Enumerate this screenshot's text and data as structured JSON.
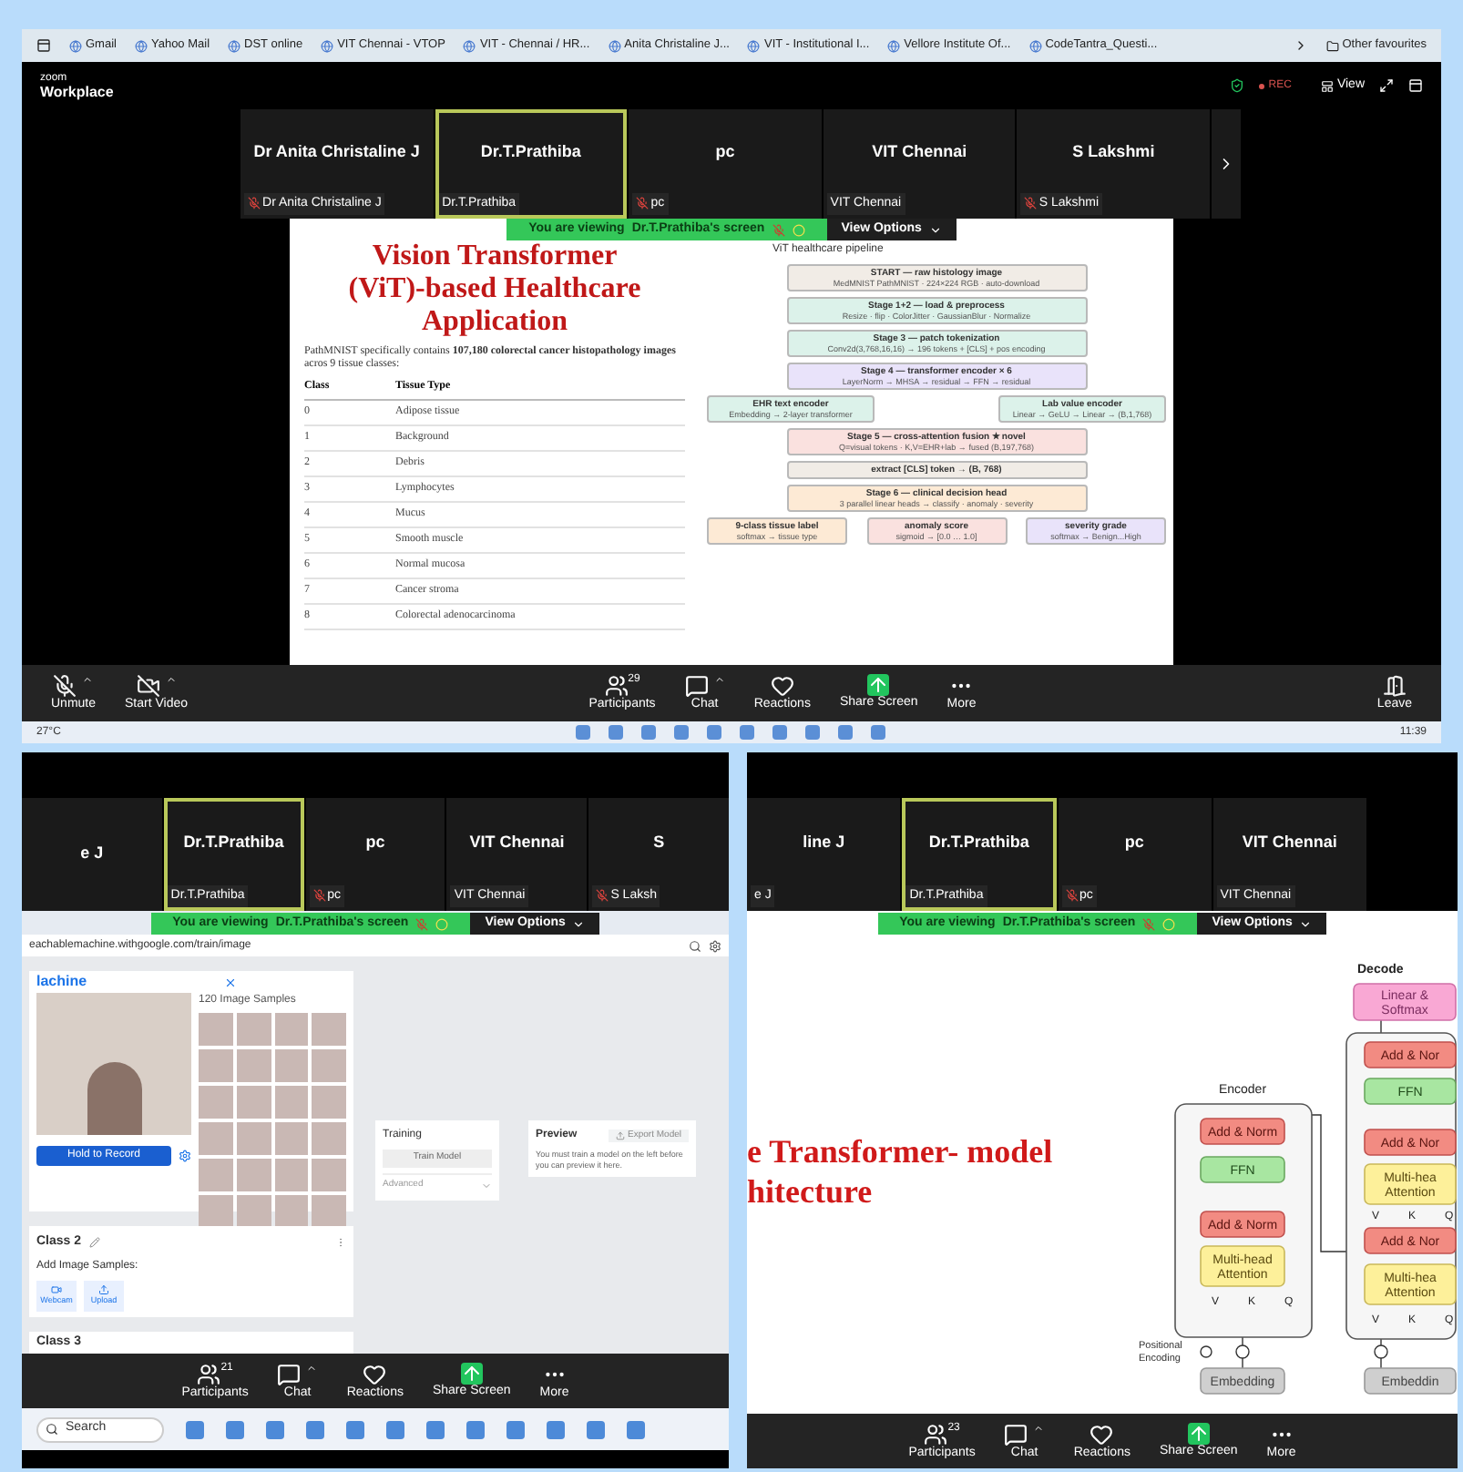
{
  "bookmarks": {
    "items": [
      "Gmail",
      "Yahoo Mail",
      "DST online",
      "VIT Chennai - VTOP",
      "VIT - Chennai / HR...",
      "Anita Christaline J...",
      "VIT - Institutional I...",
      "Vellore Institute Of...",
      "CodeTantra_Questi..."
    ],
    "other": "Other favourites"
  },
  "top_meeting": {
    "app_small": "zoom",
    "app_name": "Workplace",
    "rec": "REC",
    "view": "View",
    "participants": [
      {
        "title": "Dr Anita Christaline J",
        "label": "Dr Anita Christaline J",
        "muted": true,
        "selected": false
      },
      {
        "title": "Dr.T.Prathiba",
        "label": "Dr.T.Prathiba",
        "muted": false,
        "selected": true
      },
      {
        "title": "pc",
        "label": "pc",
        "muted": true,
        "selected": false
      },
      {
        "title": "VIT Chennai",
        "label": "VIT Chennai",
        "muted": false,
        "selected": false
      },
      {
        "title": "S Lakshmi",
        "label": "S Lakshmi",
        "muted": true,
        "selected": false
      }
    ],
    "banner": {
      "text": "You are viewing",
      "name": "Dr.T.Prathiba's screen",
      "view_options": "View Options"
    },
    "slide": {
      "title": "Vision Transformer (ViT)-based Healthcare Application",
      "paragraph": "PathMNIST specifically contains **107,180 colorectal cancer histopathology images** acros 9 tissue classes:",
      "columns": [
        "Class",
        "Tissue Type"
      ],
      "rows": [
        [
          "0",
          "Adipose tissue"
        ],
        [
          "1",
          "Background"
        ],
        [
          "2",
          "Debris"
        ],
        [
          "3",
          "Lymphocytes"
        ],
        [
          "4",
          "Mucus"
        ],
        [
          "5",
          "Smooth muscle"
        ],
        [
          "6",
          "Normal mucosa"
        ],
        [
          "7",
          "Cancer stroma"
        ],
        [
          "8",
          "Colorectal adenocarcinoma"
        ]
      ]
    },
    "pipeline": {
      "title": "ViT healthcare pipeline",
      "rows": [
        {
          "nodes": [
            {
              "title": "START — raw histology image",
              "sub": "MedMNIST PathMNIST · 224×224 RGB · auto-download",
              "color": "#f1ece6"
            }
          ]
        },
        {
          "nodes": [
            {
              "title": "Stage 1+2 — load & preprocess",
              "sub": "Resize · flip · ColorJitter · GaussianBlur · Normalize",
              "color": "#dcf2ea"
            }
          ]
        },
        {
          "nodes": [
            {
              "title": "Stage 3 — patch tokenization",
              "sub": "Conv2d(3,768,16,16) → 196 tokens + [CLS] + pos encoding",
              "color": "#dcf2ea"
            }
          ]
        },
        {
          "nodes": [
            {
              "title": "Stage 4 — transformer encoder × 6",
              "sub": "LayerNorm → MHSA → residual → FFN → residual",
              "color": "#e9e3fa"
            }
          ]
        },
        {
          "nodes": [
            {
              "title": "EHR text encoder",
              "sub": "Embedding → 2-layer transformer",
              "color": "#dcf2ea"
            },
            {
              "title": "Lab value encoder",
              "sub": "Linear → GeLU → Linear → (B,1,768)",
              "color": "#dcf2ea"
            }
          ]
        },
        {
          "nodes": [
            {
              "title": "Stage 5 — cross-attention fusion ★ novel",
              "sub": "Q=visual tokens · K,V=EHR+lab → fused (B,197,768)",
              "color": "#fae1df"
            }
          ]
        },
        {
          "nodes": [
            {
              "title": "extract [CLS] token → (B, 768)",
              "color": "#f1ece6"
            }
          ]
        },
        {
          "nodes": [
            {
              "title": "Stage 6 — clinical decision head",
              "sub": "3 parallel linear heads → classify · anomaly · severity",
              "color": "#fdead5"
            }
          ]
        },
        {
          "nodes": [
            {
              "title": "9-class tissue label",
              "sub": "softmax → tissue type",
              "color": "#fdead5"
            },
            {
              "title": "anomaly score",
              "sub": "sigmoid → [0.0 … 1.0]",
              "color": "#fae1df"
            },
            {
              "title": "severity grade",
              "sub": "softmax → Benign...High",
              "color": "#e9e3fa"
            }
          ]
        }
      ]
    },
    "toolbar": {
      "left": [
        {
          "label": "Unmute",
          "kind": "mic_off",
          "has_menu": true
        },
        {
          "label": "Start Video",
          "kind": "video_off",
          "has_menu": true
        }
      ],
      "center": [
        {
          "label": "Participants",
          "kind": "participants",
          "count": "29",
          "has_menu": false
        },
        {
          "label": "Chat",
          "kind": "chat",
          "has_menu": true
        },
        {
          "label": "Reactions",
          "kind": "reactions",
          "has_menu": false
        },
        {
          "label": "Share Screen",
          "kind": "share",
          "has_menu": false
        },
        {
          "label": "More",
          "kind": "more",
          "has_menu": false
        }
      ],
      "right": [
        {
          "label": "Leave",
          "kind": "leave",
          "has_menu": false
        }
      ]
    },
    "taskbar": {
      "weather": "27°C",
      "time": "11:39"
    }
  },
  "left_meeting": {
    "participants": [
      {
        "title": "e J",
        "selected": false
      },
      {
        "title": "Dr.T.Prathiba",
        "label": "Dr.T.Prathiba",
        "muted": false,
        "selected": true
      },
      {
        "title": "pc",
        "label": "pc",
        "muted": true,
        "selected": false
      },
      {
        "title": "VIT Chennai",
        "label": "VIT Chennai",
        "muted": false,
        "selected": false
      },
      {
        "title": "S",
        "label": "S Laksh",
        "muted": true,
        "selected": false
      }
    ],
    "banner": {
      "text": "You are viewing",
      "name": "Dr.T.Prathiba's screen",
      "view_options": "View Options"
    },
    "url": "eachablemachine.withgoogle.com/train/image",
    "app": {
      "logo": "lachine",
      "record_button": "Hold to Record",
      "samples": "120 Image Samples",
      "training": {
        "title": "Training",
        "button": "Train Model",
        "advanced": "Advanced"
      },
      "preview": {
        "title": "Preview",
        "button": "Export Model",
        "text": "You must train a model on the left before you can preview it here."
      },
      "class2": {
        "title": "Class 2",
        "add": "Add Image Samples:",
        "buttons": [
          "Webcam",
          "Upload"
        ]
      },
      "class3": "Class 3"
    },
    "toolbar": [
      {
        "label": "Participants",
        "kind": "participants",
        "count": "21",
        "has_menu": false
      },
      {
        "label": "Chat",
        "kind": "chat",
        "has_menu": true
      },
      {
        "label": "Reactions",
        "kind": "reactions",
        "has_menu": false
      },
      {
        "label": "Share Screen",
        "kind": "share",
        "has_menu": false
      },
      {
        "label": "More",
        "kind": "more",
        "has_menu": false
      }
    ],
    "taskbar_search": "Search"
  },
  "right_meeting": {
    "participants": [
      {
        "title": "line J",
        "label": "e J",
        "muted": false,
        "selected": false
      },
      {
        "title": "Dr.T.Prathiba",
        "label": "Dr.T.Prathiba",
        "muted": false,
        "selected": true
      },
      {
        "title": "pc",
        "label": "pc",
        "muted": true,
        "selected": false
      },
      {
        "title": "VIT Chennai",
        "label": "VIT Chennai",
        "muted": false,
        "selected": false
      }
    ],
    "banner": {
      "text": "You are viewing",
      "name": "Dr.T.Prathiba's screen",
      "view_options": "View Options"
    },
    "slide_title": [
      "e Transformer- model",
      "hitecture"
    ],
    "diagram": {
      "encoder": "Encoder",
      "decoder": "Decode",
      "blocks": [
        {
          "kind": "linear",
          "lines": [
            "Linear &",
            "Softmax"
          ]
        },
        {
          "kind": "add_norm",
          "lines": [
            "Add & Norm"
          ]
        },
        {
          "kind": "ffn",
          "lines": [
            "FFN"
          ]
        },
        {
          "kind": "add_norm",
          "lines": [
            "Add & Norm"
          ]
        },
        {
          "kind": "attention",
          "lines": [
            "Multi-head",
            "Attention"
          ]
        },
        {
          "kind": "add_norm",
          "lines": [
            "Add & Nor"
          ]
        },
        {
          "kind": "ffn",
          "lines": [
            "FFN"
          ]
        },
        {
          "kind": "add_norm",
          "lines": [
            "Add & Nor"
          ]
        },
        {
          "kind": "attention",
          "lines": [
            "Multi-hea",
            "Attention"
          ]
        },
        {
          "kind": "add_norm",
          "lines": [
            "Add & Nor"
          ]
        },
        {
          "kind": "attention",
          "lines": [
            "Multi-hea",
            "Attention"
          ]
        },
        {
          "kind": "embedding",
          "lines": [
            "Embedding"
          ]
        },
        {
          "kind": "embedding",
          "lines": [
            "Embeddin"
          ]
        }
      ],
      "vkq": [
        [
          "V",
          "K",
          "Q"
        ],
        [
          "V",
          "K",
          "Q"
        ],
        [
          "V",
          "K",
          "Q"
        ]
      ],
      "positional": [
        "Positional",
        "Encoding"
      ]
    },
    "toolbar": [
      {
        "label": "Participants",
        "kind": "participants",
        "count": "23",
        "has_menu": false
      },
      {
        "label": "Chat",
        "kind": "chat",
        "has_menu": true
      },
      {
        "label": "Reactions",
        "kind": "reactions",
        "has_menu": false
      },
      {
        "label": "Share Screen",
        "kind": "share",
        "has_menu": false
      },
      {
        "label": "More",
        "kind": "more",
        "has_menu": false
      }
    ]
  }
}
